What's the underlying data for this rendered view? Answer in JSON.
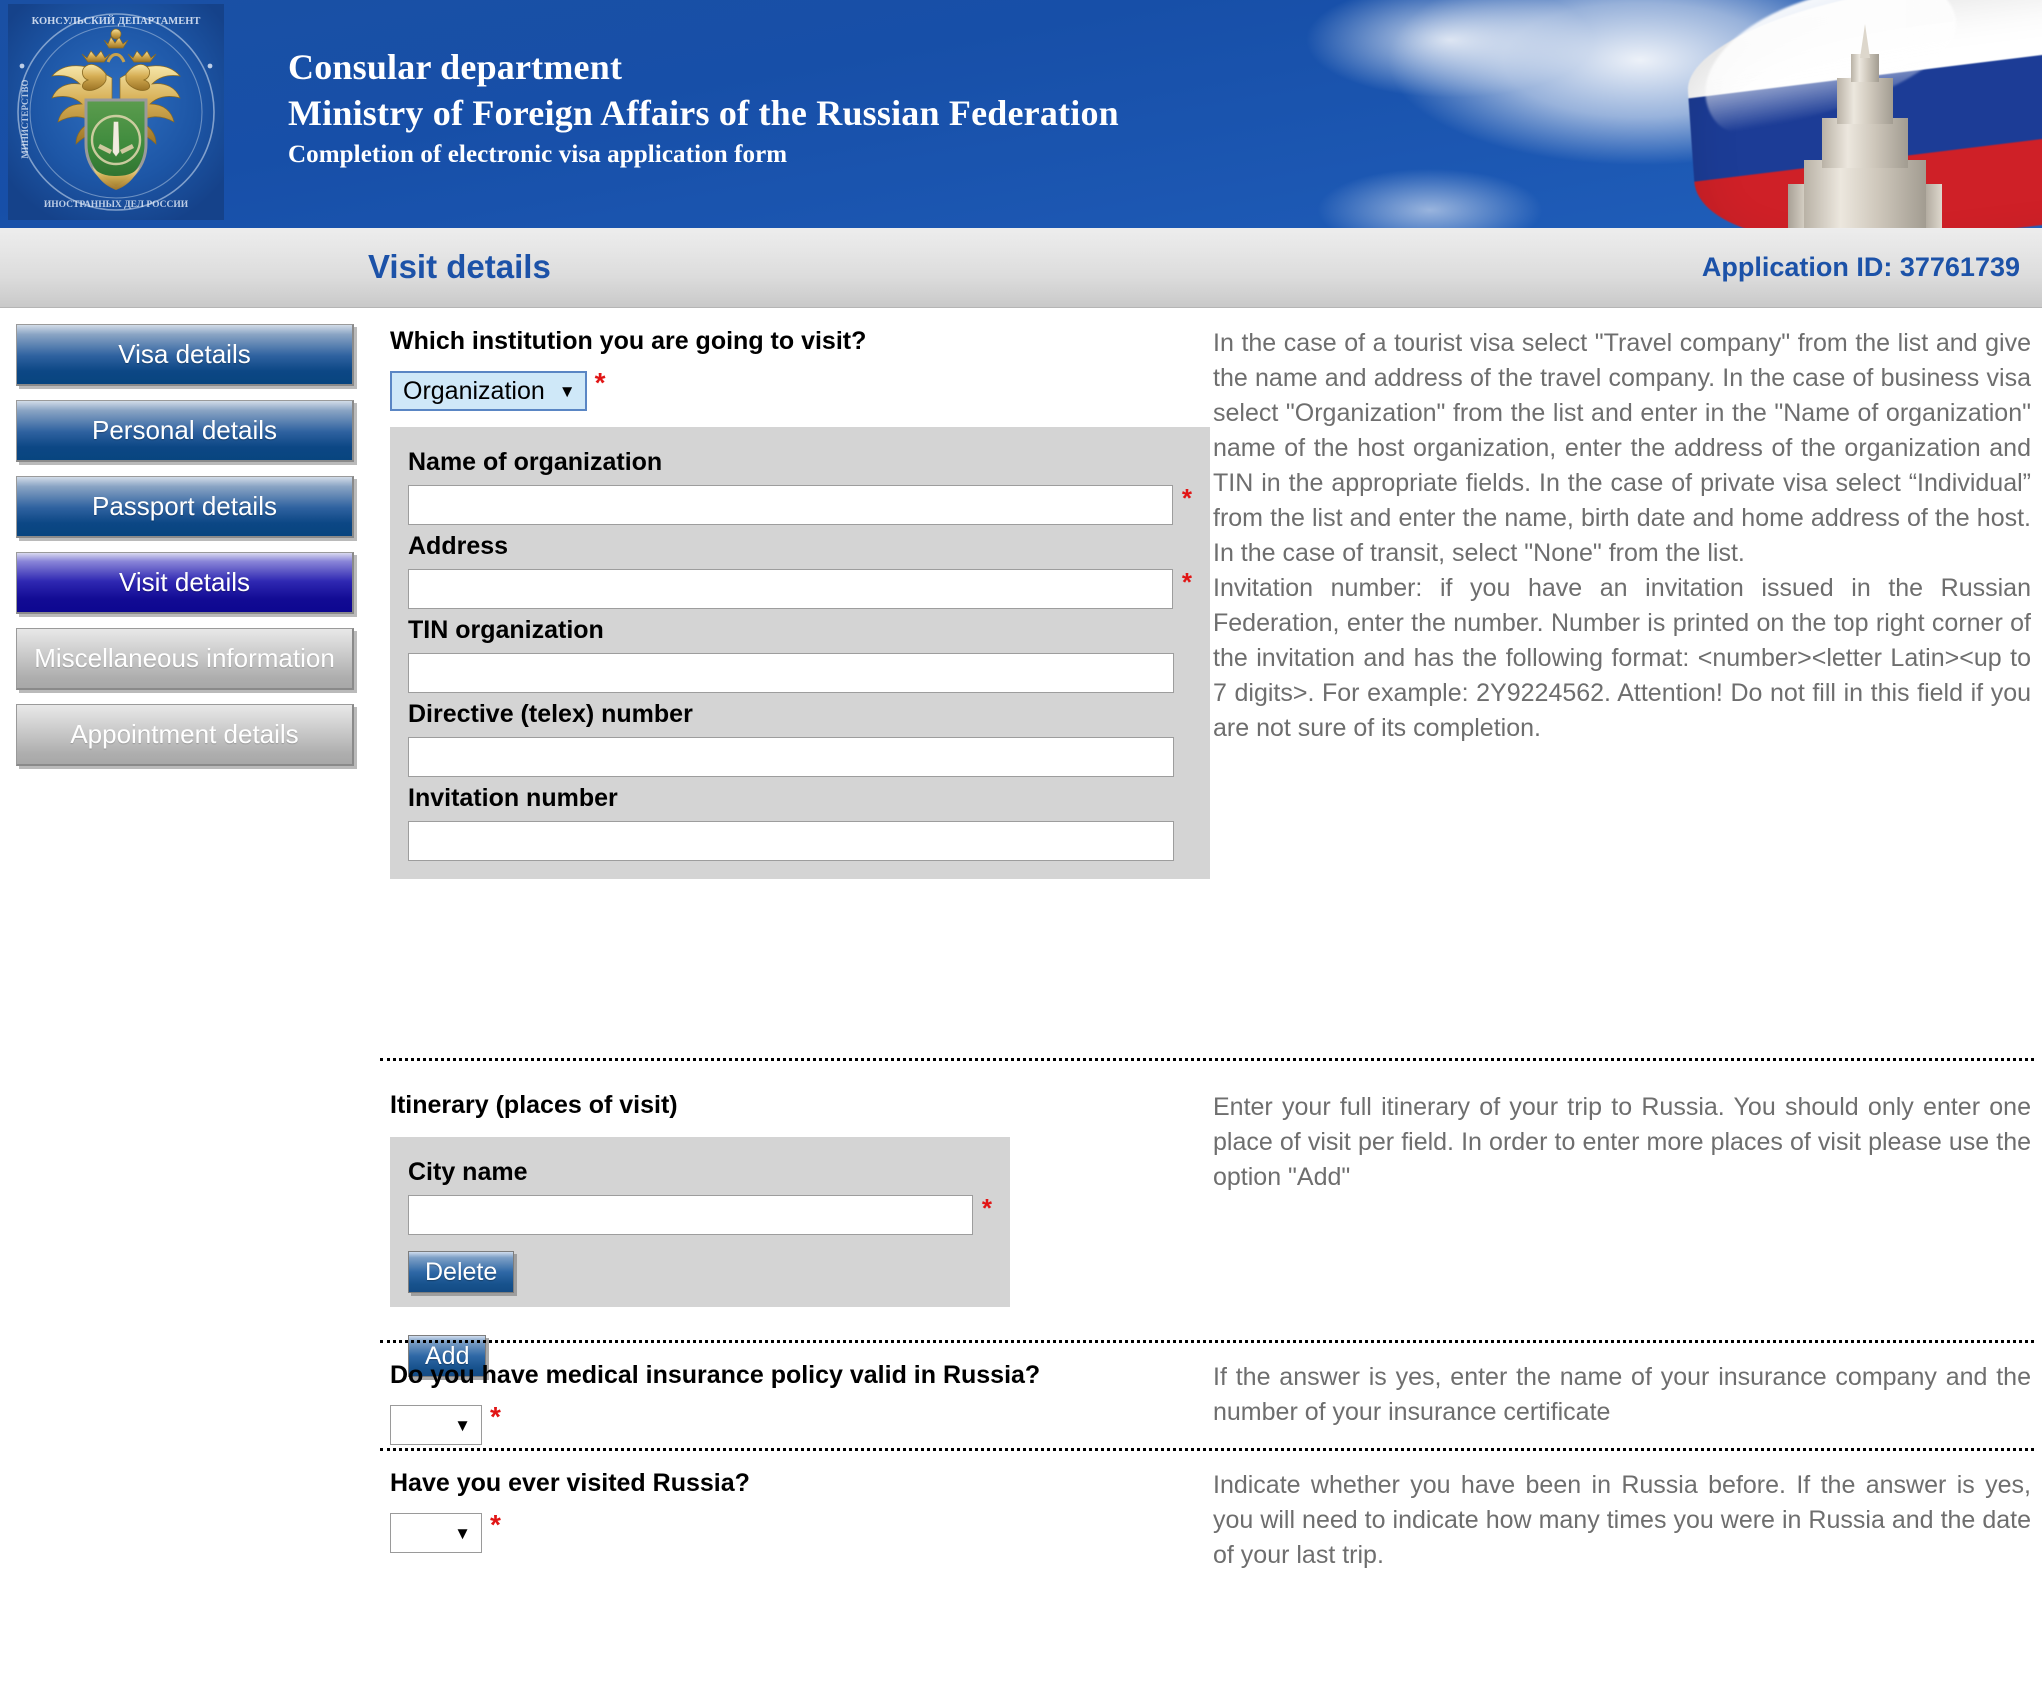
{
  "banner": {
    "emblem_alt": "emblem-consular-department-mfa-russia",
    "line1": "Consular department",
    "line2": "Ministry of Foreign Affairs of the Russian Federation",
    "line3": "Completion of electronic visa application form",
    "flag_colors": [
      "#ffffff",
      "#1c3c96",
      "#cf2027"
    ],
    "background_color": "#1b4f9c"
  },
  "titlebar": {
    "title": "Visit details",
    "application_id_label": "Application ID: 37761739",
    "title_color": "#1c52a8"
  },
  "sidebar": {
    "items": [
      {
        "label": "Visa details",
        "state": "enabled"
      },
      {
        "label": "Personal details",
        "state": "enabled"
      },
      {
        "label": "Passport details",
        "state": "enabled"
      },
      {
        "label": "Visit details",
        "state": "active"
      },
      {
        "label": "Miscellaneous information",
        "state": "disabled"
      },
      {
        "label": "Appointment details",
        "state": "disabled"
      }
    ]
  },
  "sections": {
    "institution": {
      "question": "Which institution you are going to visit?",
      "select_value": "Organization",
      "select_caret": "▼",
      "required_marker": "*",
      "fields": [
        {
          "label": "Name of organization",
          "value": "",
          "required": true
        },
        {
          "label": "Address",
          "value": "",
          "required": true
        },
        {
          "label": "TIN organization",
          "value": "",
          "required": false
        },
        {
          "label": "Directive (telex) number",
          "value": "",
          "required": false
        },
        {
          "label": "Invitation number",
          "value": "",
          "required": false
        }
      ],
      "help": "In the case of a tourist visa select \"Travel company\" from the list and give the name and address of the travel company. In the case of business visa select \"Organization\" from the list and enter in the \"Name of organization\" name of the host organization, enter the address of the organization and TIN in the appropriate fields. In the case of private visa select “Individual” from the list and enter the name, birth date and home address of the host. In the case of transit, select \"None\" from the list.",
      "help2": "Invitation number: if you have an invitation issued in the Russian Federation, enter the number. Number is printed on the top right corner of the invitation and has the following format: <number><letter Latin><up to 7 digits>. For example: 2Y9224562. Attention! Do not fill in this field if you are not sure of its completion."
    },
    "itinerary": {
      "title": "Itinerary (places of visit)",
      "city_label": "City name",
      "city_value": "",
      "required_marker": "*",
      "delete_label": "Delete",
      "add_label": "Add",
      "help": "Enter your full itinerary of your trip to Russia. You should only enter one place of visit per field. In order to enter more places of visit please use the option \"Add\""
    },
    "insurance": {
      "question": "Do you have medical insurance policy valid in Russia?",
      "select_value": "",
      "select_caret": "▼",
      "required_marker": "*",
      "help": "If the answer is yes, enter the name of your insurance company and the number of your insurance certificate"
    },
    "visited": {
      "question": "Have you ever visited Russia?",
      "select_value": "",
      "select_caret": "▼",
      "required_marker": "*",
      "help": "Indicate whether you have been in Russia before. If the answer is yes, you will need to indicate how many times you were in Russia and the date of your last trip."
    }
  },
  "colors": {
    "accent_blue": "#1c52a8",
    "required_red": "#e11515",
    "field_box_grey": "#d4d4d4",
    "help_text_grey": "#6e6e6e"
  }
}
